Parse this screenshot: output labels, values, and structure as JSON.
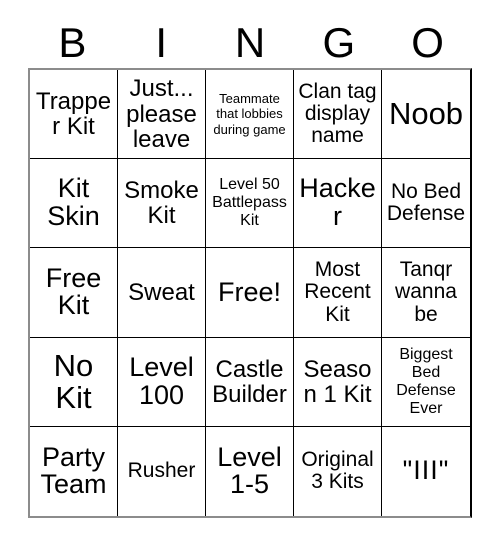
{
  "card": {
    "type": "bingo-card",
    "columns": 5,
    "rows": 5,
    "header_letters": [
      "B",
      "I",
      "N",
      "G",
      "O"
    ],
    "colors": {
      "text": "#000000",
      "background": "#ffffff",
      "grid_line": "#000000",
      "outer_border": "#8c8c8c"
    },
    "cells": [
      {
        "text": "Trapper Kit",
        "size": "lg",
        "free_space": false
      },
      {
        "text": "Just... please leave",
        "size": "lg",
        "free_space": false
      },
      {
        "text": "Teammate that lobbies during game",
        "size": "xs",
        "free_space": false
      },
      {
        "text": "Clan tag display name",
        "size": "md",
        "free_space": false
      },
      {
        "text": "Noob",
        "size": "xxl",
        "free_space": false
      },
      {
        "text": "Kit Skin",
        "size": "xl",
        "free_space": false
      },
      {
        "text": "Smoke Kit",
        "size": "lg",
        "free_space": false
      },
      {
        "text": "Level 50 Battlepass Kit",
        "size": "sm",
        "free_space": false
      },
      {
        "text": "Hacker",
        "size": "xl",
        "free_space": false
      },
      {
        "text": "No Bed Defense",
        "size": "md",
        "free_space": false
      },
      {
        "text": "Free Kit",
        "size": "xl",
        "free_space": false
      },
      {
        "text": "Sweat",
        "size": "lg",
        "free_space": false
      },
      {
        "text": "Free!",
        "size": "xl",
        "free_space": true
      },
      {
        "text": "Most Recent Kit",
        "size": "md",
        "free_space": false
      },
      {
        "text": "Tanqr wanna be",
        "size": "md",
        "free_space": false
      },
      {
        "text": "No Kit",
        "size": "xxl",
        "free_space": false
      },
      {
        "text": "Level 100",
        "size": "xl",
        "free_space": false
      },
      {
        "text": "Castle Builder",
        "size": "lg",
        "free_space": false
      },
      {
        "text": "Season 1 Kit",
        "size": "lg",
        "free_space": false
      },
      {
        "text": "Biggest Bed Defense Ever",
        "size": "sm",
        "free_space": false
      },
      {
        "text": "Party Team",
        "size": "xl",
        "free_space": false
      },
      {
        "text": "Rusher",
        "size": "md",
        "free_space": false
      },
      {
        "text": "Level 1-5",
        "size": "xl",
        "free_space": false
      },
      {
        "text": "Original 3 Kits",
        "size": "md",
        "free_space": false
      },
      {
        "text": "\"III\"",
        "size": "xl",
        "free_space": false
      }
    ]
  }
}
